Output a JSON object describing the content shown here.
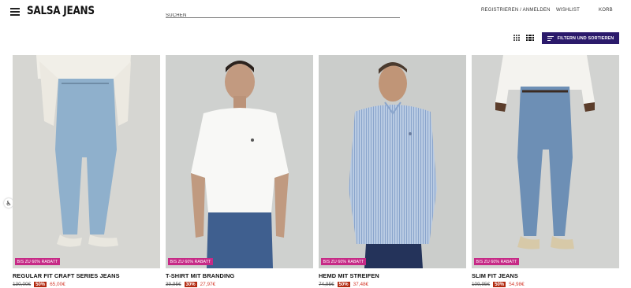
{
  "header": {
    "logo": "SALSA JEANS",
    "search_placeholder": "SUCHEN",
    "nav": {
      "register": "REGISTRIEREN / ANMELDEN",
      "wishlist": "WISHLIST",
      "cart": "KORB"
    }
  },
  "toolbar": {
    "filter_label": "FILTERN UND SORTIEREN"
  },
  "colors": {
    "accent": "#2b1a6b",
    "badge": "#c62a86",
    "discount": "#b22a10",
    "sale_price": "#d33a2c"
  },
  "products": [
    {
      "badge": "BIS ZU 60% RABATT",
      "name": "REGULAR FIT CRAFT SERIES JEANS",
      "old_price": "130,00€",
      "discount": "50%",
      "new_price": "65,00€"
    },
    {
      "badge": "BIS ZU 60% RABATT",
      "name": "T-SHIRT MIT BRANDING",
      "old_price": "39,95€",
      "discount": "30%",
      "new_price": "27,97€"
    },
    {
      "badge": "BIS ZU 60% RABATT",
      "name": "HEMD MIT STREIFEN",
      "old_price": "74,95€",
      "discount": "50%",
      "new_price": "37,48€"
    },
    {
      "badge": "BIS ZU 60% RABATT",
      "name": "SLIM FIT JEANS",
      "old_price": "109,95€",
      "discount": "50%",
      "new_price": "54,98€"
    }
  ]
}
